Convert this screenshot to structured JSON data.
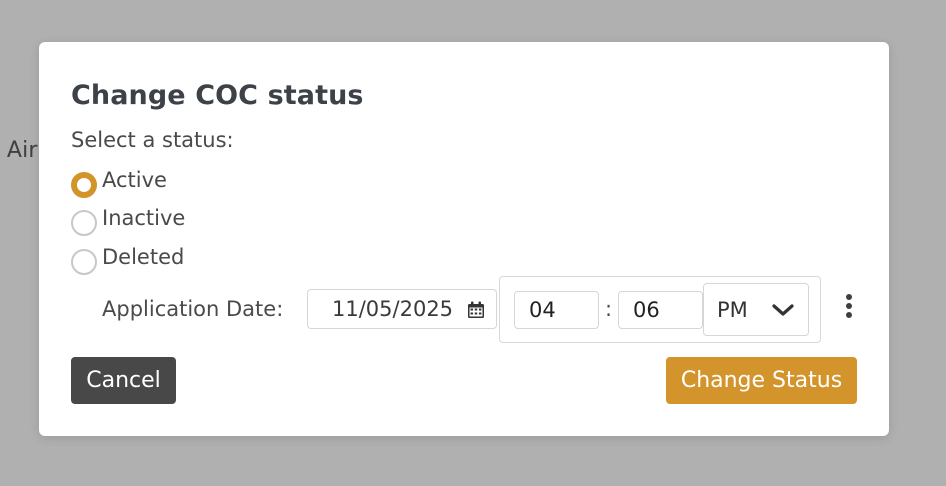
{
  "background": {
    "partial_text": "s Air"
  },
  "modal": {
    "title": "Change COC status",
    "prompt": "Select a status:",
    "statuses": [
      {
        "label": "Active",
        "checked": true
      },
      {
        "label": "Inactive",
        "checked": false
      },
      {
        "label": "Deleted",
        "checked": false
      }
    ],
    "application_date_label": "Application Date:",
    "date_value": "11/05/2025",
    "time": {
      "hour": "04",
      "separator": ":",
      "minute": "06",
      "ampm": "PM"
    },
    "cancel_label": "Cancel",
    "submit_label": "Change Status"
  },
  "colors": {
    "accent": "#d4942c",
    "cancel": "#484848",
    "overlay": "#b0b0b0"
  },
  "icons": {
    "date": "calendar-icon",
    "ampm": "chevron-down-icon",
    "menu": "more-vertical-icon"
  }
}
